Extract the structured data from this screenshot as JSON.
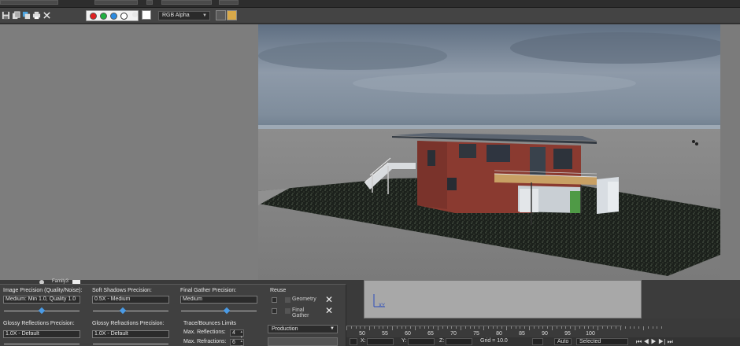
{
  "toolbar": {
    "channel_dropdown": "RGB Alpha"
  },
  "panel": {
    "image_precision": {
      "label": "Image Precision (Quality/Noise):",
      "value": "Medium: Min 1.0, Quality 1.0",
      "slider_level": 0.5
    },
    "soft_shadows": {
      "label": "Soft Shadows Precision:",
      "value": "0.5X - Medium",
      "slider_level": 0.4
    },
    "final_gather": {
      "label": "Final Gather Precision:",
      "value": "Medium",
      "slider_level": 0.6
    },
    "glossy_reflections": {
      "label": "Glossy Reflections Precision:",
      "value": "1.0X - Default"
    },
    "glossy_refractions": {
      "label": "Glossy Refractions Precision:",
      "value": "1.0X - Default"
    },
    "trace": {
      "label": "Trace/Bounces Limits",
      "max_reflections_label": "Max. Reflections:",
      "max_reflections": "4",
      "max_refractions_label": "Max. Refractions:",
      "max_refractions": "6"
    },
    "reuse": {
      "label": "Reuse",
      "geometry": "Geometry",
      "final_gather": "Final Gather"
    },
    "preset": "Production"
  },
  "scene_label": "Family3",
  "timeline": {
    "ticks": [
      "50",
      "55",
      "60",
      "65",
      "70",
      "75",
      "80",
      "85",
      "90",
      "95",
      "100"
    ]
  },
  "status": {
    "x_label": "X:",
    "y_label": "Y:",
    "z_label": "Z:",
    "grid": "Grid = 10.0",
    "auto": "Auto",
    "selected": "Selected"
  },
  "colors": {
    "accent_blue": "#4a9be6",
    "channel_red": "#e02020",
    "channel_green": "#20b040",
    "channel_blue": "#2a8ae0"
  }
}
